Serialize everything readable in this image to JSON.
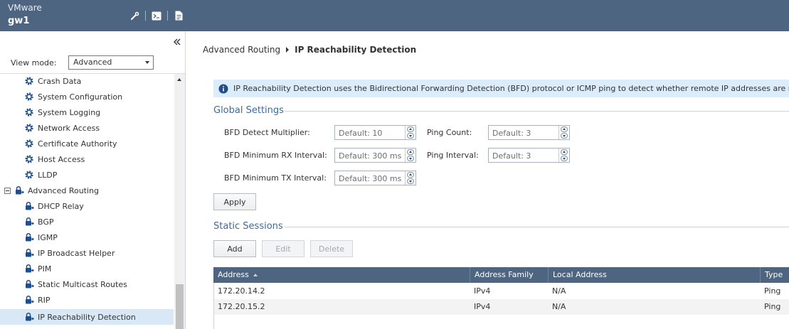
{
  "header": {
    "brand": "VMware",
    "device": "gw1"
  },
  "sidebar": {
    "view_mode_label": "View mode:",
    "view_mode_value": "Advanced",
    "items": [
      {
        "label": "Crash Data",
        "icon": "gear-icon"
      },
      {
        "label": "System Configuration",
        "icon": "gear-icon"
      },
      {
        "label": "System Logging",
        "icon": "gear-icon"
      },
      {
        "label": "Network Access",
        "icon": "gear-icon"
      },
      {
        "label": "Certificate Authority",
        "icon": "gear-icon"
      },
      {
        "label": "Host Access",
        "icon": "gear-icon"
      },
      {
        "label": "LLDP",
        "icon": "gear-icon"
      },
      {
        "label": "Advanced Routing",
        "icon": "routing-lock-icon"
      },
      {
        "label": "DHCP Relay",
        "icon": "routing-lock-icon"
      },
      {
        "label": "BGP",
        "icon": "routing-lock-icon"
      },
      {
        "label": "IGMP",
        "icon": "routing-lock-icon"
      },
      {
        "label": "IP Broadcast Helper",
        "icon": "routing-lock-icon"
      },
      {
        "label": "PIM",
        "icon": "routing-lock-icon"
      },
      {
        "label": "Static Multicast Routes",
        "icon": "routing-lock-icon"
      },
      {
        "label": "RIP",
        "icon": "routing-lock-icon"
      },
      {
        "label": "IP Reachability Detection",
        "icon": "routing-lock-icon"
      }
    ]
  },
  "breadcrumb": {
    "parent": "Advanced Routing",
    "current": "IP Reachability Detection"
  },
  "info": "IP Reachability Detection uses the Bidirectional Forwarding Detection (BFD) protocol or ICMP ping to detect whether remote IP addresses are reachable.",
  "global_settings": {
    "title": "Global Settings",
    "bfd_multiplier_label": "BFD Detect Multiplier:",
    "bfd_multiplier_placeholder": "Default: 10",
    "bfd_rx_label": "BFD Minimum RX Interval:",
    "bfd_rx_placeholder": "Default: 300 ms",
    "bfd_tx_label": "BFD Minimum TX Interval:",
    "bfd_tx_placeholder": "Default: 300 ms",
    "ping_count_label": "Ping Count:",
    "ping_count_placeholder": "Default: 3",
    "ping_interval_label": "Ping Interval:",
    "ping_interval_placeholder": "Default: 3",
    "apply_label": "Apply"
  },
  "static_sessions": {
    "title": "Static Sessions",
    "add_label": "Add",
    "edit_label": "Edit",
    "delete_label": "Delete",
    "columns": [
      "Address",
      "Address Family",
      "Local Address",
      "Type"
    ],
    "rows": [
      {
        "address": "172.20.14.2",
        "family": "IPv4",
        "local": "N/A",
        "type": "Ping"
      },
      {
        "address": "172.20.15.2",
        "family": "IPv4",
        "local": "N/A",
        "type": "Ping"
      }
    ]
  },
  "colors": {
    "header_bg": "#4d6580",
    "accent": "#3d6b9a",
    "info_bg": "#dcecfb",
    "selected_bg": "#d8e8f7"
  }
}
